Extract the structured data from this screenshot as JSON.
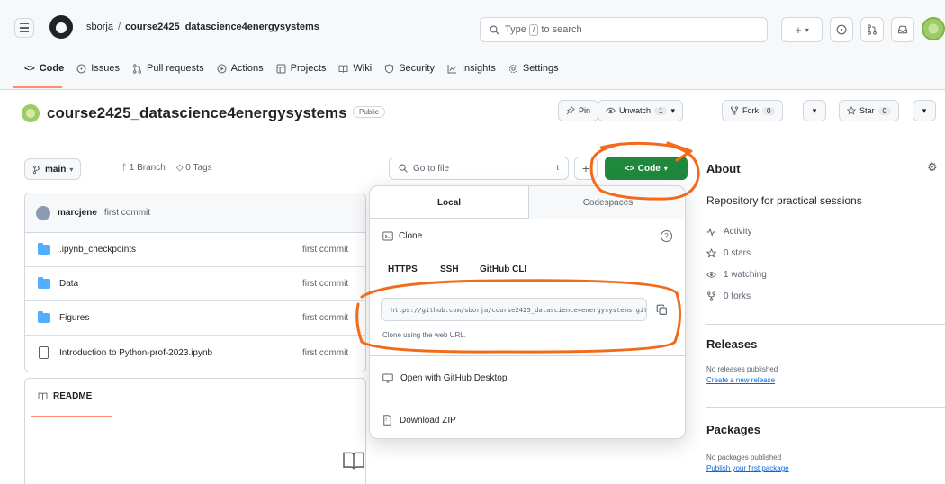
{
  "header": {
    "owner": "sborja",
    "repo": "course2425_datascience4energysystems",
    "search_prefix": "Type",
    "search_key": "/",
    "search_suffix": "to search",
    "plus": "+"
  },
  "nav": {
    "code": "Code",
    "issues": "Issues",
    "pull_requests": "Pull requests",
    "actions": "Actions",
    "projects": "Projects",
    "wiki": "Wiki",
    "security": "Security",
    "insights": "Insights",
    "settings": "Settings"
  },
  "repo": {
    "title": "course2425_datascience4energysystems",
    "visibility": "Public",
    "pin": "Pin",
    "unwatch": "Unwatch",
    "watch_count": "1",
    "fork": "Fork",
    "fork_count": "0",
    "star": "Star",
    "star_count": "0"
  },
  "browser": {
    "branch": "main",
    "branches": "1 Branch",
    "tags": "0 Tags",
    "goto_placeholder": "Go to file",
    "goto_key": "t",
    "code_label": "Code",
    "latest_user": "marcjene",
    "latest_msg": "first commit",
    "files": [
      {
        "name": ".ipynb_checkpoints",
        "commit": "first commit",
        "type": "folder"
      },
      {
        "name": "Data",
        "commit": "first commit",
        "type": "folder"
      },
      {
        "name": "Figures",
        "commit": "first commit",
        "type": "folder"
      },
      {
        "name": "Introduction to Python-prof-2023.ipynb",
        "commit": "first commit",
        "type": "file"
      }
    ],
    "readme": "README"
  },
  "dropdown": {
    "tab_local": "Local",
    "tab_codespaces": "Codespaces",
    "clone": "Clone",
    "protocols": [
      "HTTPS",
      "SSH",
      "GitHub CLI"
    ],
    "url": "https://github.com/sborja/course2425_datascience4energysystems.git",
    "url_hint": "Clone using the web URL.",
    "open_desktop": "Open with GitHub Desktop",
    "download_zip": "Download ZIP"
  },
  "sidebar": {
    "about": "About",
    "description": "Repository for practical sessions",
    "activity": "Activity",
    "stars": "0 stars",
    "watching": "1 watching",
    "forks": "0 forks",
    "releases": "Releases",
    "no_releases": "No releases published",
    "create_release": "Create a new release",
    "packages": "Packages",
    "no_packages": "No packages published",
    "publish_package": "Publish your first package"
  },
  "colors": {
    "primary_button": "#1f883d",
    "annotation": "#f26b1d",
    "link": "#0969da"
  }
}
